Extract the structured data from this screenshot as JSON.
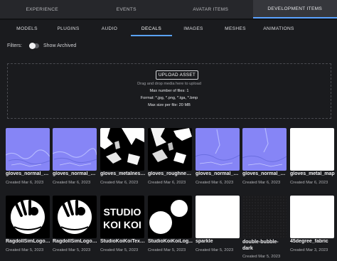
{
  "top_tabs": [
    "EXPERIENCE",
    "EVENTS",
    "AVATAR ITEMS",
    "DEVELOPMENT ITEMS"
  ],
  "top_active": "DEVELOPMENT ITEMS",
  "sub_tabs": [
    "MODELS",
    "PLUGINS",
    "AUDIO",
    "DECALS",
    "IMAGES",
    "MESHES",
    "ANIMATIONS"
  ],
  "sub_active": "DECALS",
  "filters": {
    "label": "Filters:",
    "toggle_label": "Show Archived",
    "show_archived": false
  },
  "upload": {
    "button": "UPLOAD ASSET",
    "hint": "Drag and drop media here to upload",
    "max_files": "Max number of files: 1",
    "formats": "Format: *.jpg, *.png, *.tga, *.bmp",
    "max_size": "Max size per file: 20 MB"
  },
  "assets": [
    {
      "name": "gloves_normal_m...",
      "date": "Created Mar 6, 2023",
      "thumb": "normal-map"
    },
    {
      "name": "gloves_normal_m...",
      "date": "Created Mar 6, 2023",
      "thumb": "normal-map"
    },
    {
      "name": "gloves_metalness...",
      "date": "Created Mar 6, 2023",
      "thumb": "metalness-map"
    },
    {
      "name": "gloves_roughness...",
      "date": "Created Mar 6, 2023",
      "thumb": "roughness-map"
    },
    {
      "name": "gloves_normal_m...",
      "date": "Created Mar 6, 2023",
      "thumb": "normal-map"
    },
    {
      "name": "gloves_normal_m...",
      "date": "Created Mar 6, 2023",
      "thumb": "normal-map"
    },
    {
      "name": "gloves_metal_map",
      "date": "Created Mar 6, 2023",
      "thumb": "white"
    },
    {
      "name": "RagdollSimLogo_...",
      "date": "Created Mar 5, 2023",
      "thumb": "ragdoll-logo"
    },
    {
      "name": "RagdollSimLogo_...",
      "date": "Created Mar 5, 2023",
      "thumb": "ragdoll-logo"
    },
    {
      "name": "StudioKoiKoiText...",
      "date": "Created Mar 5, 2023",
      "thumb": "studio-koikoi-text",
      "logo_text": [
        "STUDIO",
        "KOI KOI"
      ]
    },
    {
      "name": "StudioKoiKoiLog...",
      "date": "Created Mar 5, 2023",
      "thumb": "koikoi-logo"
    },
    {
      "name": "sparkle",
      "date": "Created Mar 5, 2023",
      "thumb": "white"
    },
    {
      "name": "double-bubble-dark",
      "date": "Created Mar 5, 2023",
      "thumb": "dark"
    },
    {
      "name": "45degree_fabric",
      "date": "Created Mar 3, 2023",
      "thumb": "white"
    }
  ]
}
